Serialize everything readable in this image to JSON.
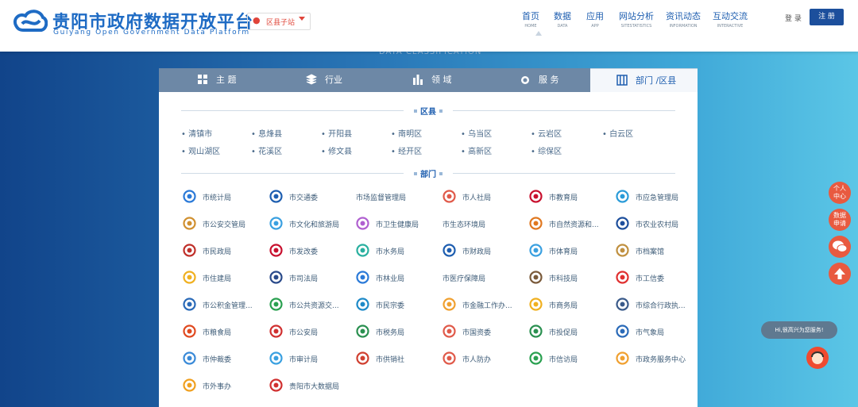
{
  "header": {
    "title_cn": "贵阳市政府数据开放平台",
    "title_en": "Guiyang Open Government Data Platform",
    "site_select": "区县子站",
    "nav": [
      {
        "cn": "首页",
        "en": "HOME"
      },
      {
        "cn": "数据",
        "en": "DATA"
      },
      {
        "cn": "应用",
        "en": "APP"
      },
      {
        "cn": "网站分析",
        "en": "SITESTATISTICS"
      },
      {
        "cn": "资讯动态",
        "en": "INFORMATION"
      },
      {
        "cn": "互动交流",
        "en": "INTERACTIVE"
      }
    ],
    "login": "登 录",
    "register": "注 册"
  },
  "classification_title": "DATA CLASSIFICATION",
  "tabs": [
    "主 题",
    "行业",
    "领 域",
    "服 务",
    "部门 /区县"
  ],
  "districts_title": "区县",
  "districts": [
    "清镇市",
    "息烽县",
    "开阳县",
    "南明区",
    "乌当区",
    "云岩区",
    "白云区",
    "观山湖区",
    "花溪区",
    "修文县",
    "经开区",
    "高新区",
    "综保区"
  ],
  "departments_title": "部门",
  "departments": [
    "市统计局",
    "市交通委",
    "市场监督管理局",
    "市人社局",
    "市教育局",
    "市应急管理局",
    "市公安交管局",
    "市文化和旅游局",
    "市卫生健康局",
    "市生态环境局",
    "市自然资源和...",
    "市农业农村局",
    "市民政局",
    "市发改委",
    "市水务局",
    "市财政局",
    "市体育局",
    "市档案馆",
    "市住建局",
    "市司法局",
    "市林业局",
    "市医疗保障局",
    "市科技局",
    "市工信委",
    "市公积金管理...",
    "市公共资源交...",
    "市民宗委",
    "市金融工作办...",
    "市商务局",
    "市综合行政执...",
    "市粮食局",
    "市公安局",
    "市税务局",
    "市国资委",
    "市投促局",
    "市气象局",
    "市仲裁委",
    "市审计局",
    "市供销社",
    "市人防办",
    "市信访局",
    "市政务服务中心",
    "市外事办",
    "贵阳市大数据局"
  ],
  "side_buttons": [
    "个人\n中心",
    "数据\n申请"
  ],
  "chat_greeting": "Hi,很高兴为您服务!",
  "colors": {
    "brand": "#1e6bc4",
    "accent": "#e85a40",
    "tab_bar": "#6d88a6"
  }
}
